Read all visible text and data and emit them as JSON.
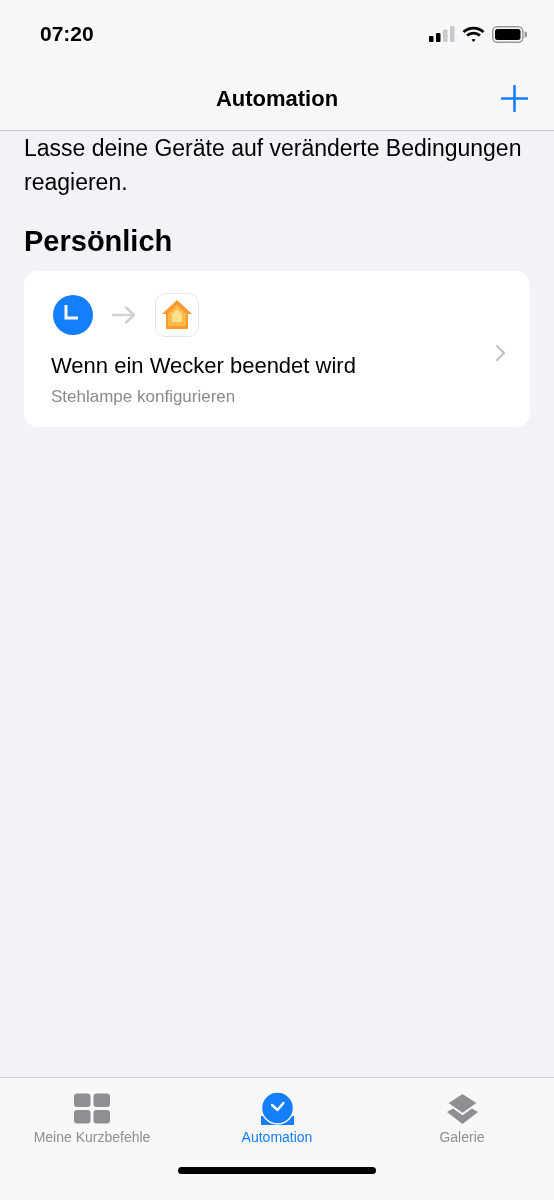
{
  "status_bar": {
    "time": "07:20"
  },
  "nav_bar": {
    "title": "Automation"
  },
  "description": "Lasse deine Geräte auf veränderte Bedingungen reagieren.",
  "section": {
    "title": "Persönlich"
  },
  "automations": [
    {
      "title": "Wenn ein Wecker beendet wird",
      "subtitle": "Stehlampe konfigurieren"
    }
  ],
  "tabs": [
    {
      "kind": "grid",
      "label": "Meine Kurzbefehle",
      "selected": false
    },
    {
      "kind": "automation",
      "label": "Automation",
      "selected": true
    },
    {
      "kind": "layers",
      "label": "Galerie",
      "selected": false
    }
  ]
}
